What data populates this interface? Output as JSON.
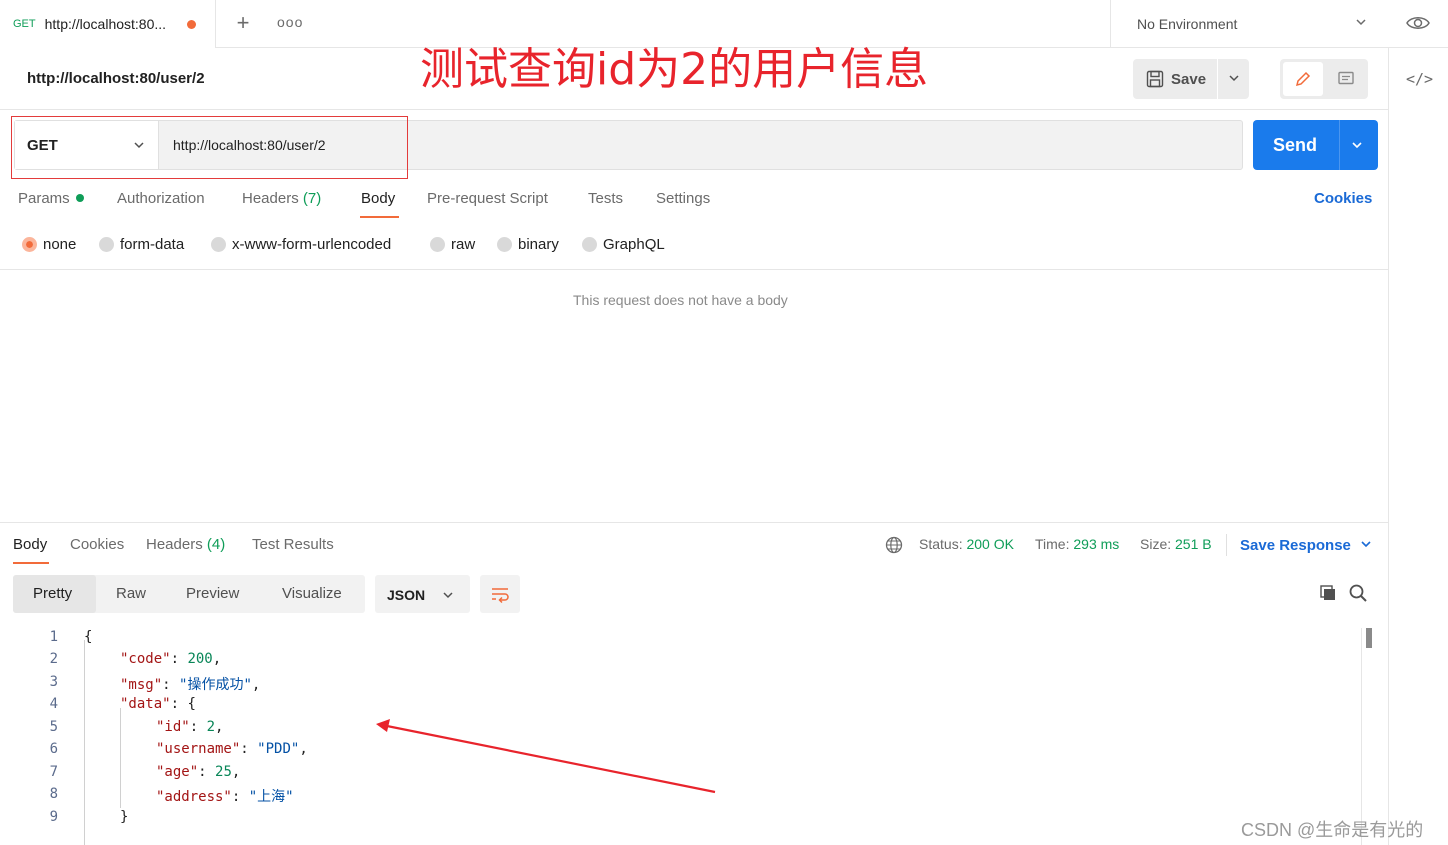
{
  "tab": {
    "method": "GET",
    "title": "http://localhost:80...",
    "new_tab": "+",
    "more": "ooo"
  },
  "environment": {
    "label": "No Environment"
  },
  "request": {
    "name": "http://localhost:80/user/2",
    "method": "GET",
    "url": "http://localhost:80/user/2",
    "save_label": "Save",
    "send_label": "Send"
  },
  "annotation": "测试查询id为2的用户信息",
  "request_tabs": {
    "params": "Params",
    "authorization": "Authorization",
    "headers": "Headers",
    "headers_count": "(7)",
    "body": "Body",
    "pre_request": "Pre-request Script",
    "tests": "Tests",
    "settings": "Settings",
    "cookies": "Cookies"
  },
  "body_types": {
    "selected": "none",
    "none": "none",
    "form_data": "form-data",
    "urlencoded": "x-www-form-urlencoded",
    "raw": "raw",
    "binary": "binary",
    "graphql": "GraphQL"
  },
  "no_body_message": "This request does not have a body",
  "response": {
    "tabs": {
      "body": "Body",
      "cookies": "Cookies",
      "headers": "Headers",
      "headers_count": "(4)",
      "test_results": "Test Results"
    },
    "status_label": "Status:",
    "status_value": "200 OK",
    "time_label": "Time:",
    "time_value": "293 ms",
    "size_label": "Size:",
    "size_value": "251 B",
    "save_response": "Save Response",
    "views": {
      "pretty": "Pretty",
      "raw": "Raw",
      "preview": "Preview",
      "visualize": "Visualize"
    },
    "format": "JSON",
    "lines": [
      {
        "num": "1",
        "text": "{"
      },
      {
        "num": "2",
        "key": "\"code\"",
        "sep": ": ",
        "num_val": "200",
        "tail": ","
      },
      {
        "num": "3",
        "key": "\"msg\"",
        "sep": ": ",
        "str_val": "\"操作成功\"",
        "tail": ","
      },
      {
        "num": "4",
        "key": "\"data\"",
        "sep": ": ",
        "tail": "{"
      },
      {
        "num": "5",
        "key": "\"id\"",
        "sep": ": ",
        "num_val": "2",
        "tail": ","
      },
      {
        "num": "6",
        "key": "\"username\"",
        "sep": ": ",
        "str_val": "\"PDD\"",
        "tail": ","
      },
      {
        "num": "7",
        "key": "\"age\"",
        "sep": ": ",
        "num_val": "25",
        "tail": ","
      },
      {
        "num": "8",
        "key": "\"address\"",
        "sep": ": ",
        "str_val": "\"上海\"",
        "tail": ""
      },
      {
        "num": "9",
        "text": "}"
      }
    ]
  },
  "watermark": "CSDN @生命是有光的",
  "colors": {
    "accent": "#f26b3a",
    "send": "#1a7bec",
    "link": "#1a6ad6",
    "success": "#0f9d58",
    "annotation": "#e8242c"
  }
}
